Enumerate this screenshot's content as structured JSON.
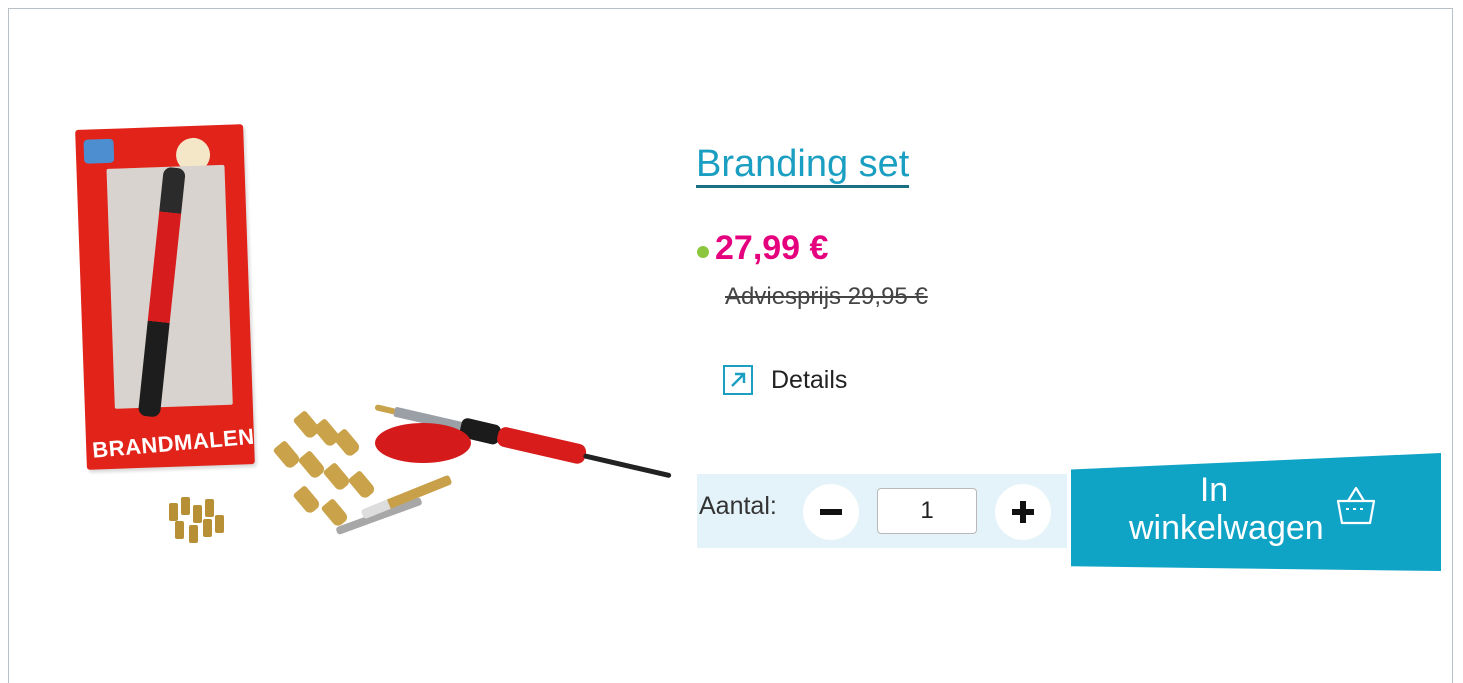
{
  "product": {
    "title": "Branding set",
    "price": "27,99 €",
    "msrp": "Adviesprijs 29,95 €",
    "box_label": "BRANDMALEN",
    "stock_color": "#8cc63f",
    "price_color": "#e5007d",
    "accent_color": "#1a9ec1"
  },
  "details": {
    "label": "Details",
    "icon": "external-link-arrow-icon"
  },
  "quantity": {
    "label": "Aantal:",
    "value": "1",
    "minus_icon": "minus-icon",
    "plus_icon": "plus-icon"
  },
  "cart": {
    "label_line1": "In",
    "label_line2": "winkelwagen",
    "icon": "basket-icon"
  }
}
